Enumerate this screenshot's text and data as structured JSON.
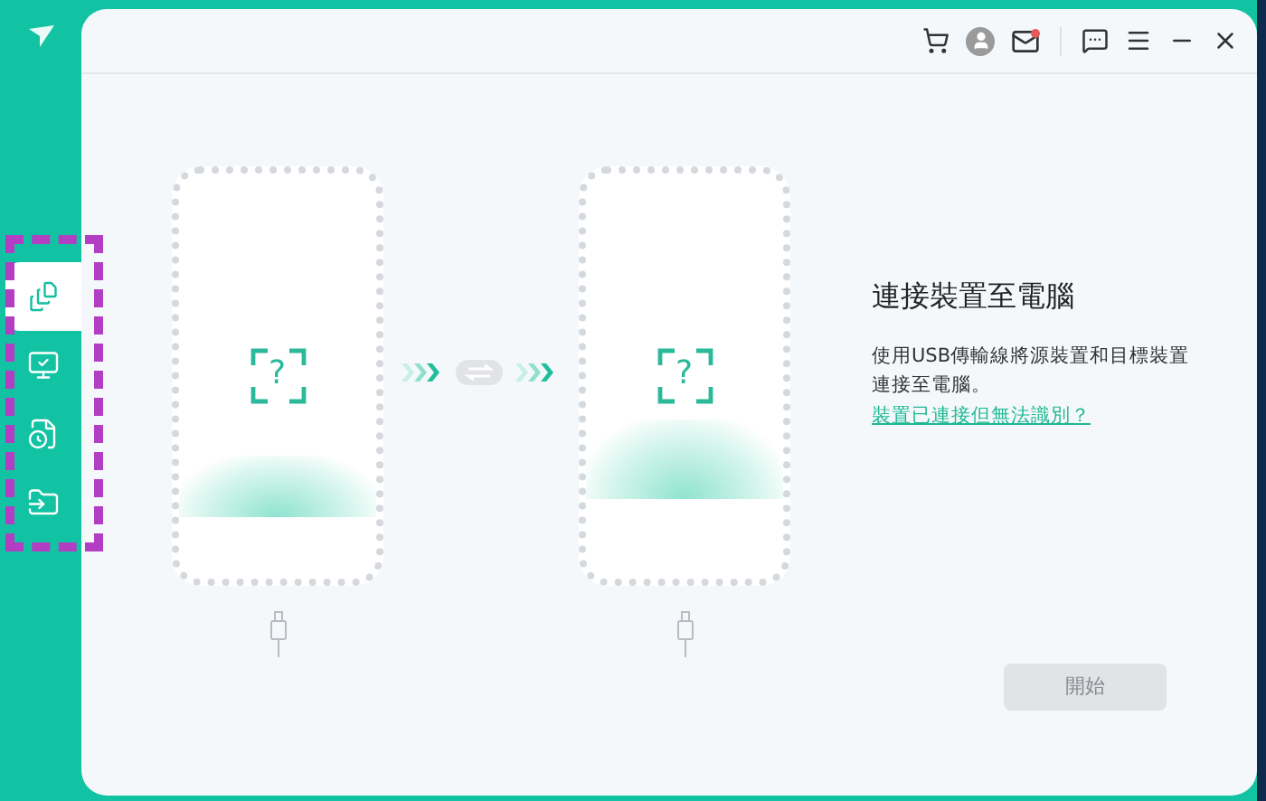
{
  "sidebar": {
    "items": [
      {
        "kind": "transfer",
        "selected": true
      },
      {
        "kind": "screen",
        "selected": false
      },
      {
        "kind": "restore",
        "selected": false
      },
      {
        "kind": "folder",
        "selected": false
      }
    ]
  },
  "title_bar": {
    "mail_unread": true
  },
  "phones": [
    {
      "symbol": "?"
    },
    {
      "symbol": "?"
    }
  ],
  "headline": "連接裝置至電腦",
  "description": "使用USB傳輸線將源裝置和目標裝置連接至電腦。",
  "help_link": "裝置已連接但無法識別？",
  "start_button": {
    "label": "開始",
    "disabled": true
  }
}
